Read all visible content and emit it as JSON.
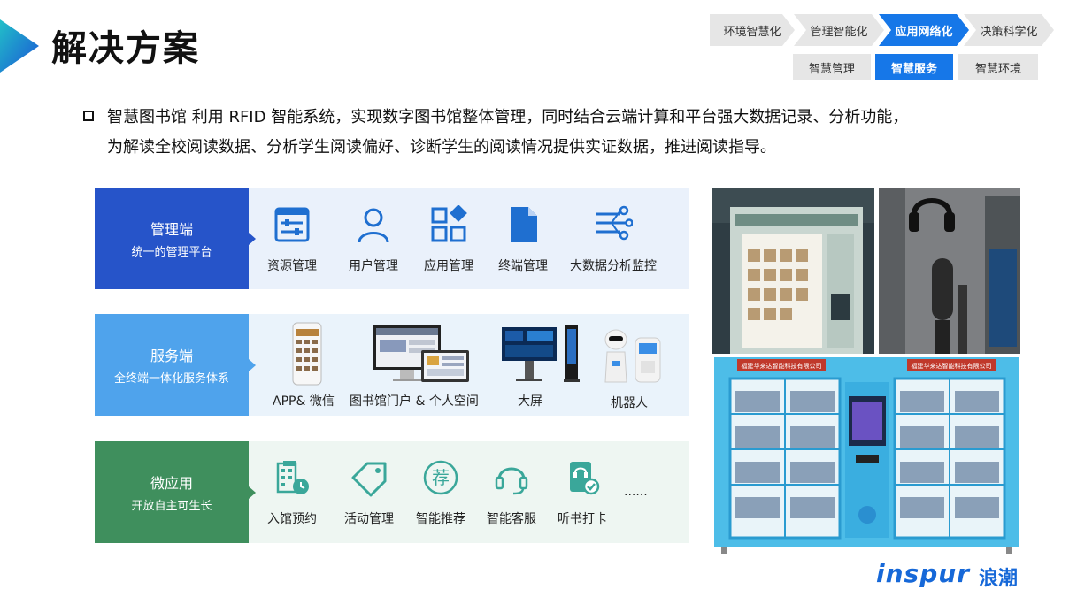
{
  "header": {
    "title": "解决方案"
  },
  "nav": {
    "steps": [
      "环境智慧化",
      "管理智能化",
      "应用网络化",
      "决策科学化"
    ],
    "active_step": 2,
    "subtabs": [
      "智慧管理",
      "智慧服务",
      "智慧环境"
    ],
    "active_subtab": 1
  },
  "intro": {
    "line1": "智慧图书馆 利用 RFID 智能系统，实现数字图书馆整体管理，同时结合云端计算和平台强大数据记录、分析功能，",
    "line2": "为解读全校阅读数据、分析学生阅读偏好、诊断学生的阅读情况提供实证数据，推进阅读指导。"
  },
  "management": {
    "title": "管理端",
    "subtitle": "统一的管理平台",
    "items": [
      "资源管理",
      "用户管理",
      "应用管理",
      "终端管理",
      "大数据分析监控"
    ]
  },
  "service": {
    "title": "服务端",
    "subtitle": "全终端一体化服务体系",
    "items": [
      "APP& 微信",
      "图书馆门户 & 个人空间",
      "大屏",
      "机器人"
    ]
  },
  "micro": {
    "title": "微应用",
    "subtitle": "开放自主可生长",
    "items": [
      "入馆预约",
      "活动管理",
      "智能推荐",
      "智能客服",
      "听书打卡"
    ],
    "more": "......",
    "recommend_glyph": "荐"
  },
  "photos": {
    "cabinet_banner_left": "福建华来达智能科技有限公司",
    "cabinet_banner_right": "福建华来达智能科技有限公司"
  },
  "brand": {
    "logo_en": "inspur",
    "logo_cn": "浪潮"
  },
  "colors": {
    "accent": "#1677e8",
    "management": "#2654c9",
    "service": "#4fa3ec",
    "micro": "#3f8f5d",
    "icon_blue": "#1f6fd0",
    "icon_teal": "#3aa79a"
  }
}
